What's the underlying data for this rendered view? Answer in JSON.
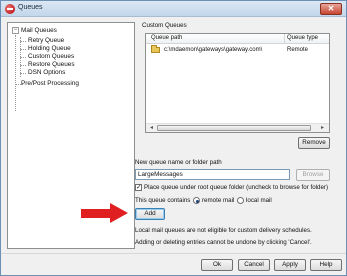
{
  "window": {
    "title": "Queues",
    "close_glyph": "✕"
  },
  "tree": {
    "root_mail": {
      "label": "Mail Queues",
      "expander": "−"
    },
    "children": [
      {
        "label": "Retry Queue"
      },
      {
        "label": "Holding Queue"
      },
      {
        "label": "Custom Queues"
      },
      {
        "label": "Restore Queues"
      },
      {
        "label": "DSN Options"
      }
    ],
    "root_prepost": {
      "label": "Pre/Post Processing"
    }
  },
  "custom_queues": {
    "group_label": "Custom Queues",
    "columns": [
      "Queue path",
      "Queue type"
    ],
    "rows": [
      {
        "path": "c:\\mdaemon\\gateways\\gateway.com\\",
        "type": "Remote"
      }
    ],
    "scroll_left": "◂",
    "scroll_right": "▸",
    "remove_label": "Remove"
  },
  "new_queue": {
    "label": "New queue name or folder path",
    "value": "LargeMessages",
    "browse_label": "Browse",
    "place_under_root_label": "Place queue under root queue folder (uncheck to browse for folder)",
    "place_under_root_checked": true,
    "contains_label": "This queue contains",
    "radio_remote_label": "remote mail",
    "radio_local_label": "local mail",
    "selected_type": "remote mail",
    "add_label": "Add"
  },
  "notes": {
    "line1": "Local mail queues are not eligible for custom delivery schedules.",
    "line2": "Adding or deleting entries cannot be undone by clicking 'Cancel'."
  },
  "footer": {
    "ok_label": "Ok",
    "cancel_label": "Cancel",
    "apply_label": "Apply",
    "help_label": "Help"
  },
  "colors": {
    "annotation_arrow": "#e02020",
    "title_bar": "#c3d6ea"
  },
  "icons": {
    "app": "app-icon",
    "folder": "folder-icon",
    "annotation": "red-arrow-icon"
  }
}
